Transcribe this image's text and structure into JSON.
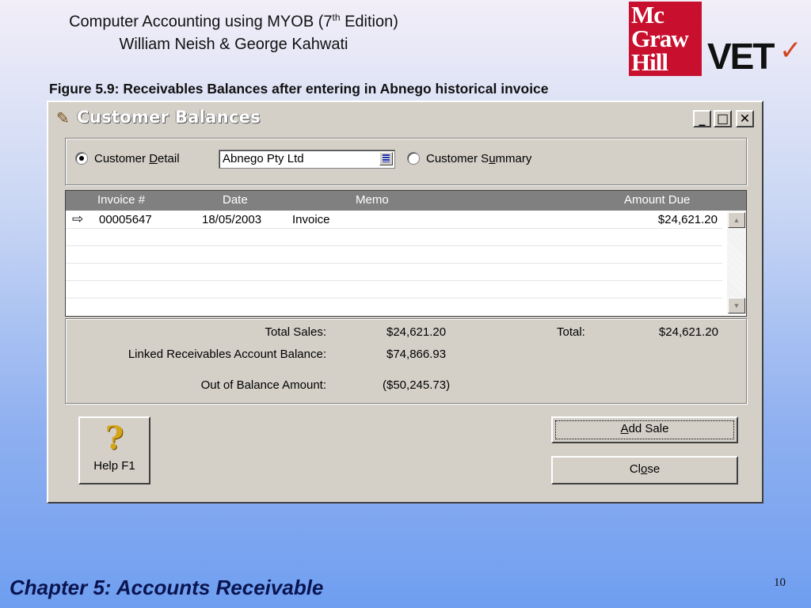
{
  "slide": {
    "title_line1_pre": "Computer Accounting using MYOB (7",
    "title_sup": "th",
    "title_line1_post": " Edition)",
    "title_line2": "William Neish & George Kahwati",
    "logo_mcgraw": "Mc Graw Hill",
    "logo_vet": "VET",
    "figure_caption": "Figure 5.9: Receivables Balances after entering in Abnego historical invoice",
    "footer": "Chapter 5: Accounts Receivable",
    "page_number": "10"
  },
  "window": {
    "title": "Customer Balances",
    "minimize_label": "_",
    "maximize_label": "□",
    "close_label": "✕"
  },
  "filter": {
    "customer_detail_label": "Customer Detail",
    "customer_detail_selected": true,
    "customer_value": "Abnego Pty Ltd",
    "customer_summary_label": "Customer Summary",
    "customer_summary_selected": false
  },
  "table": {
    "columns": [
      "Invoice #",
      "Date",
      "Memo",
      "Amount Due"
    ],
    "rows": [
      {
        "invoice": "00005647",
        "date": "18/05/2003",
        "memo": "Invoice",
        "amount": "$24,621.20"
      }
    ]
  },
  "totals": {
    "total_sales_label": "Total Sales:",
    "total_sales_value": "$24,621.20",
    "total_label": "Total:",
    "total_value": "$24,621.20",
    "linked_label": "Linked Receivables Account Balance:",
    "linked_value": "$74,866.93",
    "oob_label": "Out of Balance Amount:",
    "oob_value": "($50,245.73)"
  },
  "buttons": {
    "help_label": "Help F1",
    "add_sale_label": "Add Sale",
    "close_label": "Close"
  }
}
